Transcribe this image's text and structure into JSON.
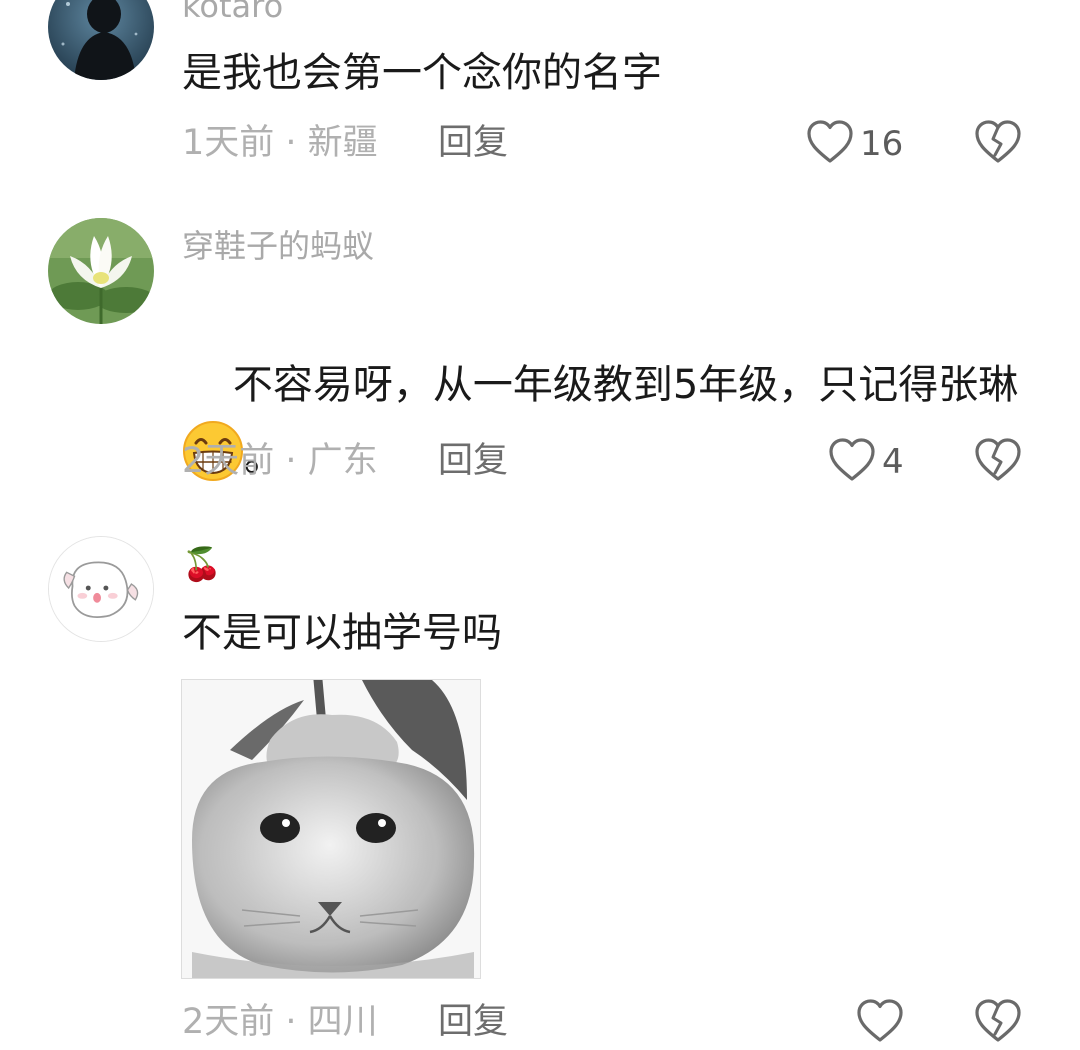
{
  "comments": [
    {
      "username": "kotaro",
      "text": "是我也会第一个念你的名字",
      "time": "1天前",
      "location": "新疆",
      "reply_label": "回复",
      "likes": "16"
    },
    {
      "username": "穿鞋子的蚂蚁",
      "text_part1": "不容易呀，从一年级教到5年级，只记得张琳",
      "text_part2": "。",
      "emoji": "grinning-face-emoji",
      "time": "2天前",
      "location": "广东",
      "reply_label": "回复",
      "likes": "4"
    },
    {
      "username": "🍒",
      "text": "不是可以抽学号吗",
      "image": "cat-orange-sticker",
      "time": "2天前",
      "location": "四川",
      "reply_label": "回复",
      "likes": ""
    }
  ],
  "separator": " · ",
  "icons": {
    "like": "heart-outline-icon",
    "dislike": "broken-heart-icon"
  },
  "colors": {
    "text": "#1a1a1a",
    "meta": "#b0b0b0",
    "username": "#a9a9a9",
    "icon": "#6a6a6a"
  }
}
